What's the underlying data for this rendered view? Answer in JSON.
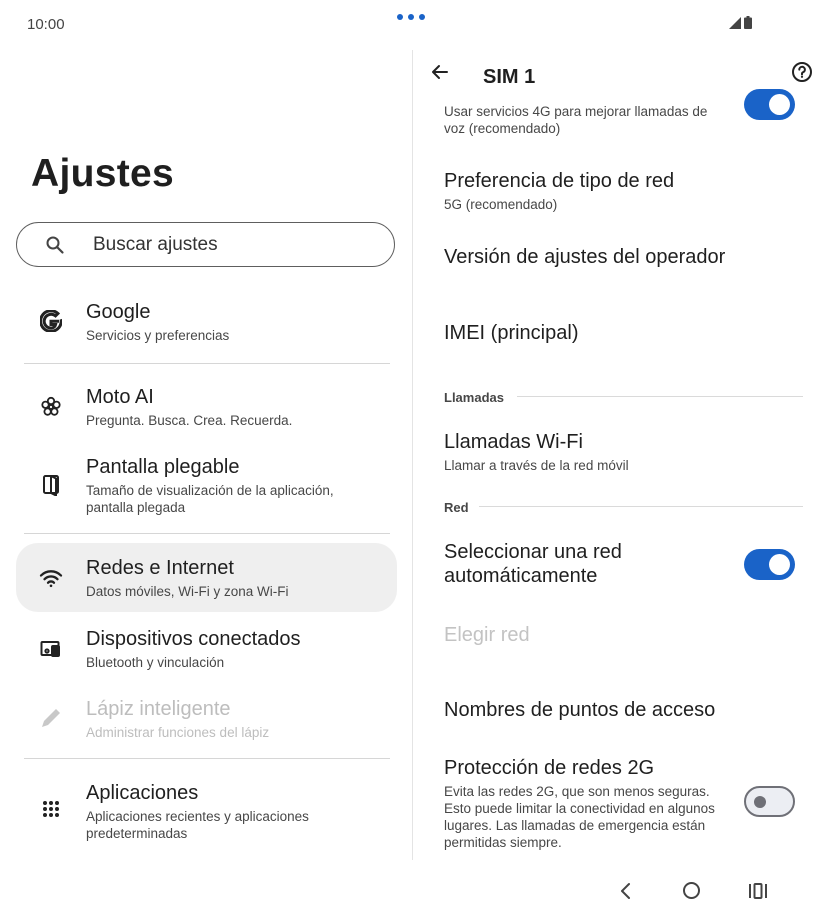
{
  "status_bar": {
    "time": "10:00"
  },
  "left_pane": {
    "title": "Ajustes",
    "search": {
      "placeholder": "Buscar ajustes"
    },
    "items": [
      {
        "title": "Google",
        "subtitle": "Servicios y preferencias",
        "icon": "google-g-icon"
      },
      {
        "title": "Moto AI",
        "subtitle": "Pregunta. Busca. Crea. Recuerda.",
        "icon": "moto-ai-flower-icon"
      },
      {
        "title": "Pantalla plegable",
        "subtitle": "Tamaño de visualización de la aplicación, pantalla plegada",
        "icon": "foldable-phone-icon"
      },
      {
        "title": "Redes e Internet",
        "subtitle": "Datos móviles, Wi-Fi y zona Wi-Fi",
        "icon": "wifi-icon",
        "selected": true
      },
      {
        "title": "Dispositivos conectados",
        "subtitle": "Bluetooth y vinculación",
        "icon": "connected-devices-icon"
      },
      {
        "title": "Lápiz inteligente",
        "subtitle": "Administrar funciones del lápiz",
        "icon": "pen-icon",
        "disabled": true
      },
      {
        "title": "Aplicaciones",
        "subtitle": "Aplicaciones recientes y aplicaciones predeterminadas",
        "icon": "apps-grid-icon"
      }
    ]
  },
  "right_pane": {
    "title": "SIM 1",
    "rows": {
      "volte": {
        "subtitle": "Usar servicios 4G para mejorar llamadas de voz (recomendado)",
        "toggle_on": true
      },
      "network_type": {
        "title": "Preferencia de tipo de red",
        "subtitle": "5G (recomendado)"
      },
      "carrier_version": {
        "title": "Versión de ajustes del operador"
      },
      "imei": {
        "title": "IMEI (principal)"
      },
      "calls_section": {
        "label": "Llamadas"
      },
      "wifi_calling": {
        "title": "Llamadas Wi-Fi",
        "subtitle": "Llamar a través de la red móvil"
      },
      "network_section": {
        "label": "Red"
      },
      "auto_select": {
        "title_line1": "Seleccionar una red",
        "title_line2": "automáticamente",
        "toggle_on": true
      },
      "choose_network": {
        "title": "Elegir red",
        "disabled": true
      },
      "apn": {
        "title": "Nombres de puntos de acceso"
      },
      "protection_2g": {
        "title": "Protección de redes 2G",
        "subtitle": "Evita las redes 2G, que son menos seguras. Esto puede limitar la conectividad en algunos lugares. Las llamadas de emergencia están permitidas siempre.",
        "toggle_on": false
      }
    }
  },
  "colors": {
    "accent": "#1a63c8",
    "selected_bg": "#efefef",
    "disabled_text": "#bdbdbd"
  }
}
